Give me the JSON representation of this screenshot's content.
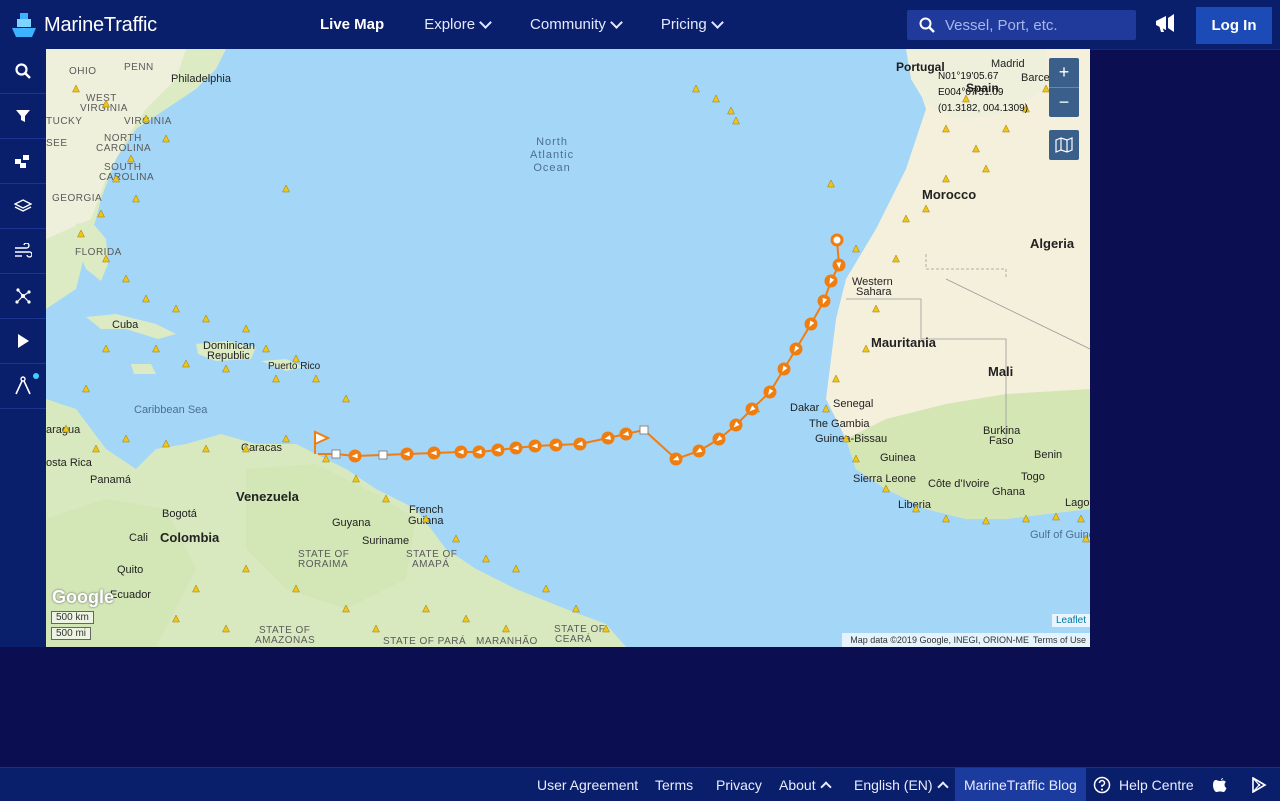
{
  "app": {
    "name": "MarineTraffic"
  },
  "nav": {
    "live_map": "Live Map",
    "explore": "Explore",
    "community": "Community",
    "pricing": "Pricing"
  },
  "search": {
    "placeholder": "Vessel, Port, etc."
  },
  "login_label": "Log In",
  "sidebar": [
    "search-icon",
    "filter-icon",
    "fleet-icon",
    "layers-icon",
    "weather-icon",
    "density-icon",
    "play-icon",
    "measure-icon"
  ],
  "map": {
    "coords": {
      "line1": "N01°19'05.67",
      "line2": "E004°07'51.09",
      "line3": "(01.3182, 004.1309)"
    },
    "zoom_in": "+",
    "zoom_out": "−",
    "labels": {
      "ocean": [
        "North",
        "Atlantic",
        "Ocean"
      ],
      "caribbean": "Caribbean Sea",
      "gulf_guinea": "Gulf of Guine",
      "portugal": "Portugal",
      "madrid": "Madrid",
      "spain": "Spain",
      "barcelona": "Barcelo",
      "morocco": "Morocco",
      "algeria": "Algeria",
      "western_sahara_1": "Western",
      "western_sahara_2": "Sahara",
      "mauritania": "Mauritania",
      "mali": "Mali",
      "senegal": "Senegal",
      "dakar": "Dakar",
      "gambia": "The Gambia",
      "guinea_bissau": "Guinea-Bissau",
      "guinea": "Guinea",
      "burkina_1": "Burkina",
      "burkina_2": "Faso",
      "benin": "Benin",
      "sierra_leone": "Sierra Leone",
      "cote_ivoire": "Côte d'Ivoire",
      "ghana": "Ghana",
      "togo": "Togo",
      "lagos": "Lago",
      "liberia": "Liberia",
      "ohio": "OHIO",
      "penn": "PENN",
      "philadelphia": "Philadelphia",
      "west_virginia_1": "WEST",
      "west_virginia_2": "VIRGINIA",
      "virginia": "VIRGINIA",
      "kentucky": "TUCKY",
      "north_carolina_1": "NORTH",
      "north_carolina_2": "CAROLINA",
      "south_carolina_1": "SOUTH",
      "south_carolina_2": "CAROLINA",
      "georgia": "GEORGIA",
      "tennessee": "SEE",
      "florida": "FLORIDA",
      "cuba": "Cuba",
      "dominican_1": "Dominican",
      "dominican_2": "Republic",
      "puerto_rico": "Puerto Rico",
      "nicaragua": "aragua",
      "costa_rica": "osta Rica",
      "panama": "Panamá",
      "caracas": "Caracas",
      "venezuela": "Venezuela",
      "bogota": "Bogotá",
      "colombia": "Colombia",
      "cali": "Cali",
      "quito": "Quito",
      "ecuador": "Ecuador",
      "guyana": "Guyana",
      "suriname": "Suriname",
      "french_guiana_1": "French",
      "french_guiana_2": "Guiana",
      "roraima_1": "STATE OF",
      "roraima_2": "RORAIMA",
      "amapa_1": "STATE OF",
      "amapa_2": "AMAPÁ",
      "amazonas_1": "STATE OF",
      "amazonas_2": "AMAZONAS",
      "para": "STATE OF PARÁ",
      "maranhao": "MARANHÃO",
      "ceara_1": "STATE OF",
      "ceara_2": "CEARÁ"
    },
    "scale_km": "500 km",
    "scale_mi": "500 mi",
    "google": "Google",
    "leaflet": "Leaflet",
    "attribution": "Map data ©2019 Google, INEGI, ORION-ME",
    "terms": "Terms of Use"
  },
  "footer": {
    "user_agreement": "User Agreement",
    "terms": "Terms",
    "privacy": "Privacy",
    "about": "About",
    "language": "English (EN)",
    "blog": "MarineTraffic Blog",
    "help": "Help Centre"
  },
  "colors": {
    "track": "#f07d10",
    "vessel": "#f0c419",
    "accent": "#1c4bb8",
    "nav_bg": "#0a1f6b",
    "page_bg": "#0b0f52"
  }
}
